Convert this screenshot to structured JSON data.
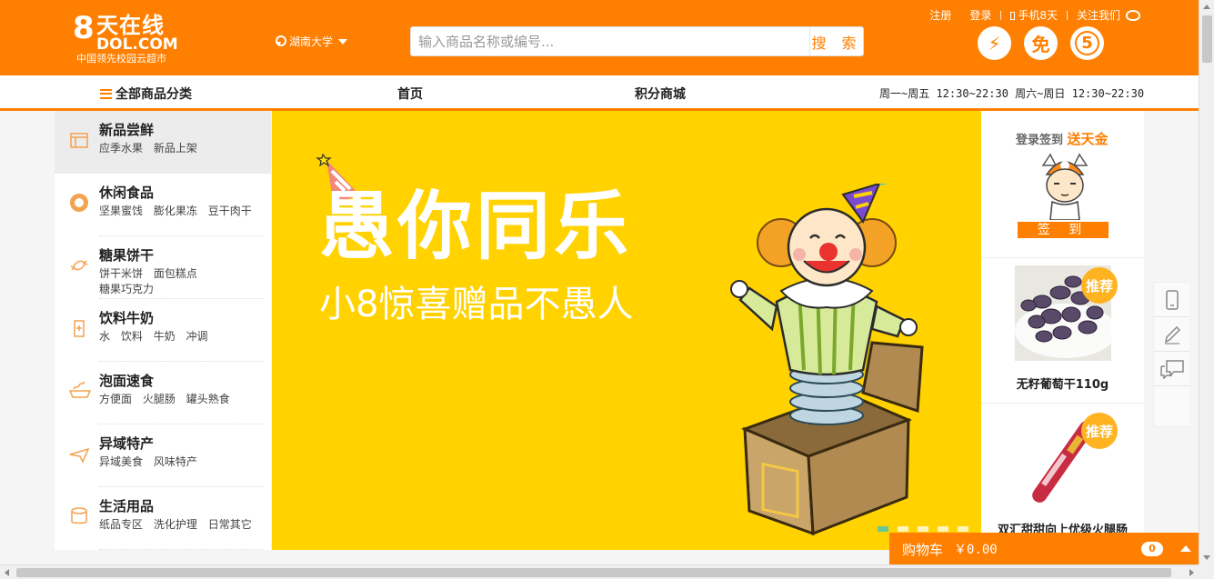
{
  "header": {
    "logo_big": "8",
    "logo_cn": "天在线",
    "logo_domain": "DOL.COM",
    "logo_slogan": "中国领先校园云超市",
    "location": "湖南大学",
    "search_placeholder": "输入商品名称或编号...",
    "search_button": "搜 索",
    "links": {
      "register": "注册",
      "login": "登录",
      "mobile": "手机8天",
      "follow": "关注我们"
    },
    "badges": {
      "lightning": "⚡",
      "free": "免",
      "five": "5"
    }
  },
  "nav": {
    "all_categories": "全部商品分类",
    "home": "首页",
    "points_mall": "积分商城",
    "hours": "周一~周五 12:30~22:30 周六~周日 12:30~22:30"
  },
  "categories": [
    {
      "title": "新品尝鲜",
      "icon": "storefront-icon",
      "subs": [
        "应季水果",
        "新品上架"
      ]
    },
    {
      "title": "休闲食品",
      "icon": "snack-icon",
      "subs": [
        "坚果蜜饯",
        "膨化果冻",
        "豆干肉干"
      ]
    },
    {
      "title": "糖果饼干",
      "icon": "candy-icon",
      "subs": [
        "饼干米饼",
        "面包糕点",
        "糖果巧克力"
      ]
    },
    {
      "title": "饮料牛奶",
      "icon": "drink-icon",
      "subs": [
        "水",
        "饮料",
        "牛奶",
        "冲调"
      ]
    },
    {
      "title": "泡面速食",
      "icon": "noodle-icon",
      "subs": [
        "方便面",
        "火腿肠",
        "罐头熟食"
      ]
    },
    {
      "title": "异域特产",
      "icon": "plane-icon",
      "subs": [
        "异域美食",
        "风味特产"
      ]
    },
    {
      "title": "生活用品",
      "icon": "tissue-icon",
      "subs": [
        "纸品专区",
        "洗化护理",
        "日常其它"
      ]
    }
  ],
  "banner": {
    "title": "愚你同乐",
    "subtitle": "小8惊喜赠品不愚人",
    "slide_count": 5,
    "active_slide": 0
  },
  "sign_in": {
    "title_prefix": "登录签到",
    "title_highlight": "送天金",
    "button": "签 到"
  },
  "recommend": [
    {
      "tag": "推荐",
      "name": "无籽葡萄干110g"
    },
    {
      "tag": "推荐",
      "name": "双汇甜甜向上优级火腿肠"
    }
  ],
  "cart": {
    "label": "购物车",
    "price": "￥0.00",
    "count": "0"
  },
  "colors": {
    "brand": "#ff7f00",
    "banner_bg": "#ffd200",
    "tag": "#ffb320"
  }
}
